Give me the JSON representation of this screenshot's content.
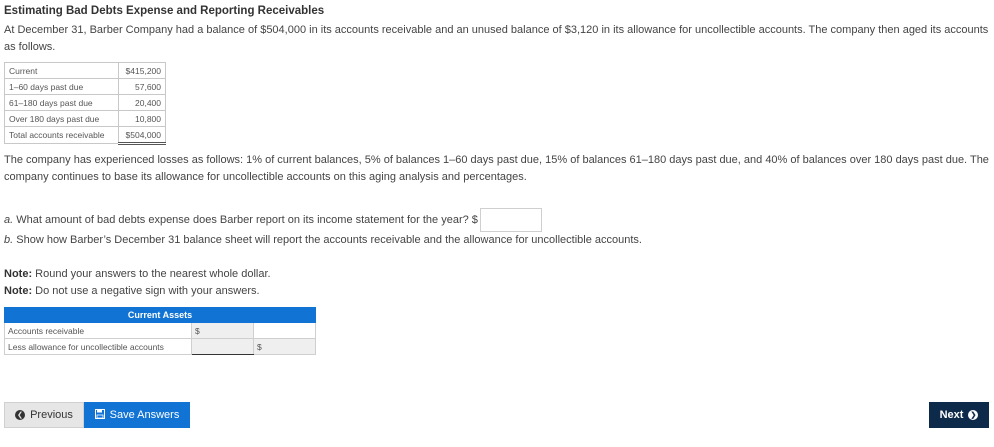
{
  "title": "Estimating Bad Debts Expense and Reporting Receivables",
  "intro": "At December 31, Barber Company had a balance of $504,000 in its accounts receivable and an unused balance of $3,120 in its allowance for uncollectible accounts. The company then aged its accounts as follows.",
  "aging": [
    {
      "label": "Current",
      "value": "$415,200"
    },
    {
      "label": "1–60 days past due",
      "value": "57,600"
    },
    {
      "label": "61–180 days past due",
      "value": "20,400"
    },
    {
      "label": "Over 180 days past due",
      "value": "10,800"
    },
    {
      "label": "Total accounts receivable",
      "value": "$504,000"
    }
  ],
  "paragraph": "The company has experienced losses as follows: 1% of current balances, 5% of balances 1–60 days past due, 15% of balances 61–180 days past due, and 40% of balances over 180 days past due. The company continues to base its allowance for uncollectible accounts on this aging analysis and percentages.",
  "question_a": {
    "letter": "a.",
    "text": "What amount of bad debts expense does Barber report on its income statement for the year? $"
  },
  "question_b": {
    "letter": "b.",
    "text": "Show how Barber’s December 31 balance sheet will report the accounts receivable and the allowance for uncollectible accounts."
  },
  "notes": [
    {
      "label": "Note:",
      "text": "Round your answers to the nearest whole dollar."
    },
    {
      "label": "Note:",
      "text": "Do not use a negative sign with your answers."
    }
  ],
  "current_assets": {
    "header": "Current Assets",
    "rows": [
      {
        "label": "Accounts receivable",
        "col1": "$",
        "col2": ""
      },
      {
        "label": "Less allowance for uncollectible accounts",
        "col1": "",
        "col2": "$"
      }
    ]
  },
  "buttons": {
    "previous": "Previous",
    "save": "Save Answers",
    "next": "Next"
  },
  "colors": {
    "accent": "#1173d4",
    "next_bg": "#0e2a4a"
  },
  "icons": {
    "previous": "chevron-left-circle-icon",
    "save": "floppy-disk-icon",
    "next": "chevron-right-circle-icon"
  }
}
